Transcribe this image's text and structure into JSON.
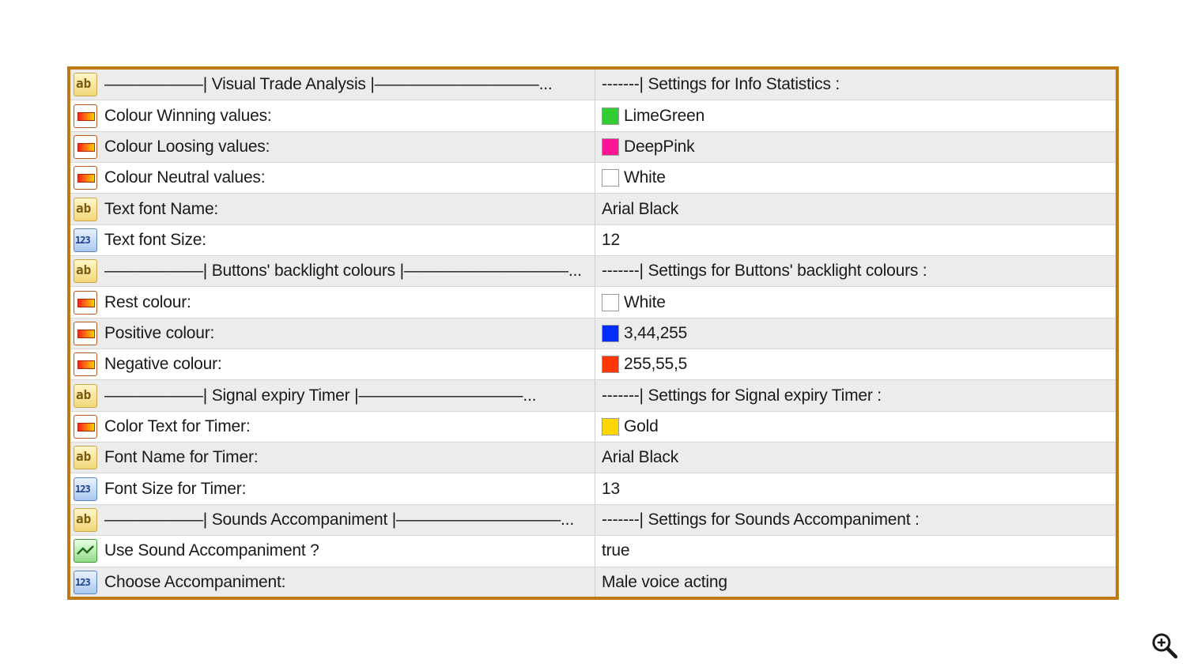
{
  "rows": [
    {
      "icon": "string-icon",
      "name": "——————| Visual Trade Analysis |——————————...",
      "value": "-------| Settings for  Info Statistics :",
      "swatch": null
    },
    {
      "icon": "color-icon",
      "name": "Colour Winning values:",
      "value": "LimeGreen",
      "swatch": "#32cd32"
    },
    {
      "icon": "color-icon",
      "name": "Colour Loosing values:",
      "value": "DeepPink",
      "swatch": "#ff1493"
    },
    {
      "icon": "color-icon",
      "name": "Colour Neutral values:",
      "value": "White",
      "swatch": "#ffffff"
    },
    {
      "icon": "string-icon",
      "name": "Text font Name:",
      "value": "Arial Black",
      "swatch": null
    },
    {
      "icon": "number-icon",
      "name": "Text font Size:",
      "value": "12",
      "swatch": null
    },
    {
      "icon": "string-icon",
      "name": "——————| Buttons' backlight colours |——————————...",
      "value": "-------| Settings for  Buttons' backlight colours :",
      "swatch": null
    },
    {
      "icon": "color-icon",
      "name": "Rest colour:",
      "value": "White",
      "swatch": "#ffffff"
    },
    {
      "icon": "color-icon",
      "name": "Positive colour:",
      "value": "3,44,255",
      "swatch": "#032cff"
    },
    {
      "icon": "color-icon",
      "name": "Negative colour:",
      "value": "255,55,5",
      "swatch": "#ff3705"
    },
    {
      "icon": "string-icon",
      "name": "——————| Signal expiry Timer |——————————...",
      "value": "-------| Settings for  Signal expiry Timer :",
      "swatch": null
    },
    {
      "icon": "color-icon",
      "name": "Color Text for Timer:",
      "value": "Gold",
      "swatch": "#ffd700"
    },
    {
      "icon": "string-icon",
      "name": "Font Name for Timer:",
      "value": "Arial Black",
      "swatch": null
    },
    {
      "icon": "number-icon",
      "name": "Font Size for Timer:",
      "value": "13",
      "swatch": null
    },
    {
      "icon": "string-icon",
      "name": "——————| Sounds Accompaniment |——————————...",
      "value": "-------| Settings for  Sounds Accompaniment :",
      "swatch": null
    },
    {
      "icon": "bool-icon",
      "name": "Use Sound Accompaniment ?",
      "value": "true",
      "swatch": null
    },
    {
      "icon": "number-icon",
      "name": "Choose Accompaniment:",
      "value": "Male voice acting",
      "swatch": null
    }
  ],
  "icons": {
    "string-icon": "ab",
    "number-icon": "123"
  },
  "colors": {
    "frame_border": "#bf7a16",
    "row_shade": "#ececec"
  },
  "zoom_icon": "zoom-in-icon"
}
